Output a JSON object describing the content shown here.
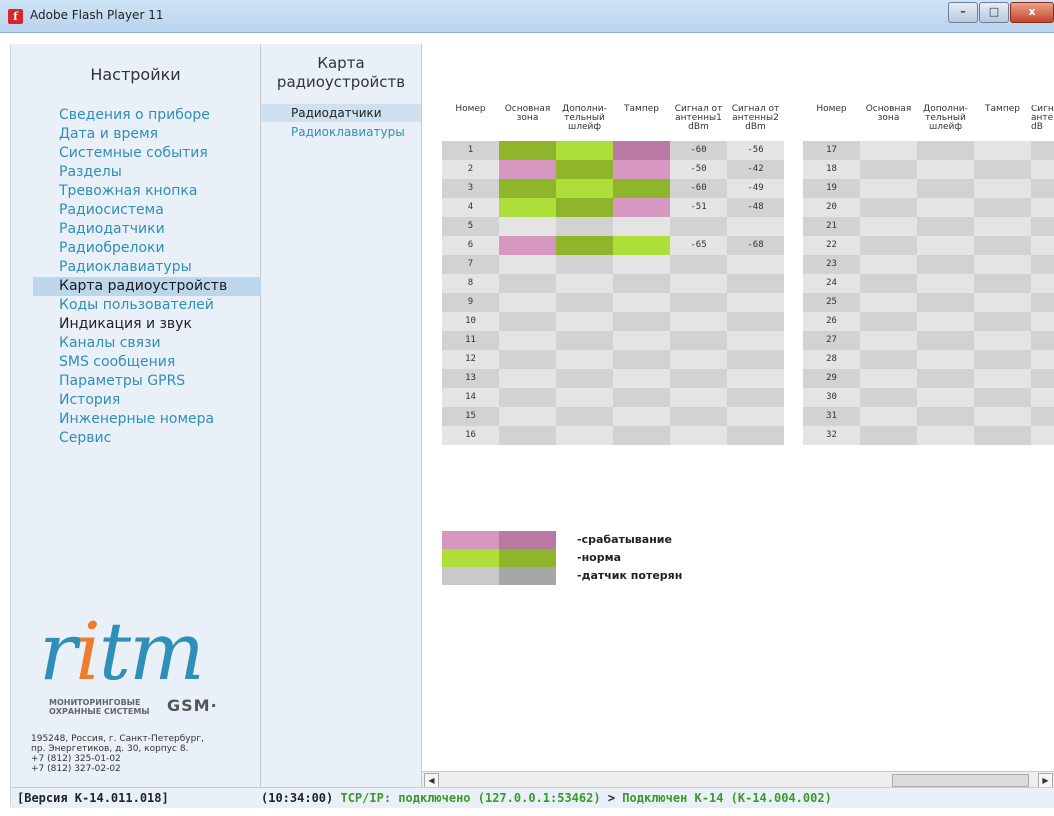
{
  "window": {
    "title": "Adobe Flash Player 11",
    "buttons": {
      "minimize": "–",
      "maximize": "□",
      "close": "x"
    }
  },
  "settings": {
    "title": "Настройки",
    "menu": [
      {
        "label": "Сведения о приборе"
      },
      {
        "label": "Дата и время"
      },
      {
        "label": "Системные события"
      },
      {
        "label": "Разделы"
      },
      {
        "label": "Тревожная кнопка"
      },
      {
        "label": "Радиосистема"
      },
      {
        "label": "Радиодатчики"
      },
      {
        "label": "Радиобрелоки"
      },
      {
        "label": "Радиоклавиатуры"
      },
      {
        "label": "Карта радиоустройств"
      },
      {
        "label": "Коды пользователей"
      },
      {
        "label": "Индикация и звук"
      },
      {
        "label": "Каналы связи"
      },
      {
        "label": "SMS сообщения"
      },
      {
        "label": "Параметры GPRS"
      },
      {
        "label": "История"
      },
      {
        "label": "Инженерные номера"
      },
      {
        "label": "Сервис"
      }
    ],
    "active_index": 9
  },
  "submenu": {
    "title_line1": "Карта",
    "title_line2": "радиоустройств",
    "items": [
      {
        "label": "Радиодатчики"
      },
      {
        "label": "Радиоклавиатуры"
      }
    ],
    "active_index": 0
  },
  "table": {
    "headers": {
      "number": "Номер",
      "main_zone": "Основная\nзона",
      "extra_loop": "Дополни-\nтельный\nшлейф",
      "tamper": "Тампер",
      "signal1": "Сигнал от\nантенны1\ndBm",
      "signal2": "Сигнал от\nантенны2\ndBm",
      "signal_cut": "Сигна\nантен\ndB"
    },
    "left_rows": [
      {
        "num": "1",
        "main": "norm-dark",
        "extra": "norm",
        "tamper": "alarm-dark",
        "s1": "-60",
        "s2": "-56"
      },
      {
        "num": "2",
        "main": "alarm",
        "extra": "norm-dark",
        "tamper": "alarm",
        "s1": "-50",
        "s2": "-42"
      },
      {
        "num": "3",
        "main": "norm-dark",
        "extra": "norm",
        "tamper": "norm-dark",
        "s1": "-60",
        "s2": "-49"
      },
      {
        "num": "4",
        "main": "norm",
        "extra": "norm-dark",
        "tamper": "alarm",
        "s1": "-51",
        "s2": "-48"
      },
      {
        "num": "5",
        "main": "",
        "extra": "",
        "tamper": "",
        "s1": "",
        "s2": ""
      },
      {
        "num": "6",
        "main": "alarm",
        "extra": "norm-dark",
        "tamper": "norm",
        "s1": "-65",
        "s2": "-68"
      },
      {
        "num": "7",
        "main": "",
        "extra": "",
        "tamper": "",
        "s1": "",
        "s2": ""
      },
      {
        "num": "8",
        "main": "",
        "extra": "",
        "tamper": "",
        "s1": "",
        "s2": ""
      },
      {
        "num": "9",
        "main": "",
        "extra": "",
        "tamper": "",
        "s1": "",
        "s2": ""
      },
      {
        "num": "10",
        "main": "",
        "extra": "",
        "tamper": "",
        "s1": "",
        "s2": ""
      },
      {
        "num": "11",
        "main": "",
        "extra": "",
        "tamper": "",
        "s1": "",
        "s2": ""
      },
      {
        "num": "12",
        "main": "",
        "extra": "",
        "tamper": "",
        "s1": "",
        "s2": ""
      },
      {
        "num": "13",
        "main": "",
        "extra": "",
        "tamper": "",
        "s1": "",
        "s2": ""
      },
      {
        "num": "14",
        "main": "",
        "extra": "",
        "tamper": "",
        "s1": "",
        "s2": ""
      },
      {
        "num": "15",
        "main": "",
        "extra": "",
        "tamper": "",
        "s1": "",
        "s2": ""
      },
      {
        "num": "16",
        "main": "",
        "extra": "",
        "tamper": "",
        "s1": "",
        "s2": ""
      }
    ],
    "right_rows": [
      "17",
      "18",
      "19",
      "20",
      "21",
      "22",
      "23",
      "24",
      "25",
      "26",
      "27",
      "28",
      "29",
      "30",
      "31",
      "32"
    ]
  },
  "legend": [
    {
      "label": "-срабатывание",
      "c1": "#d697c1",
      "c2": "#b87aa3"
    },
    {
      "label": "-норма",
      "c1": "#aede3a",
      "c2": "#8fb52a"
    },
    {
      "label": "-датчик потерян",
      "c1": "#c9c9c9",
      "c2": "#a7a7a7"
    }
  ],
  "colors": {
    "alarm": "#d697c1",
    "alarm-dark": "#b87aa3",
    "norm": "#aede3a",
    "norm-dark": "#8fb52a",
    "empty-a": "#d2d2d2",
    "empty-b": "#e4e4e4",
    "accent": "#2e8fb8",
    "status_green": "#3a9a2a"
  },
  "logo": {
    "word_r": "r",
    "word_i": "i",
    "word_t": "t",
    "word_m": "m",
    "sub_line1": "МОНИТОРИНГОВЫЕ",
    "sub_line2": "ОХРАННЫЕ СИСТЕМЫ",
    "gsm": "GSM·",
    "address": "195248, Россия, г. Санкт-Петербург,\nпр. Энергетиков, д. 30, корпус 8.\n+7 (812) 325-01-02\n+7 (812) 327-02-02"
  },
  "status": {
    "version": "[Версия К-14.011.018]",
    "time": "(10:34:00)",
    "tcp": "TCP/IP: подключено (127.0.0.1:53462)",
    "sep": ">",
    "device": "Подключен К-14 (К-14.004.002)"
  },
  "scrollbar": {
    "left_arrow": "◀",
    "right_arrow": "▶"
  }
}
